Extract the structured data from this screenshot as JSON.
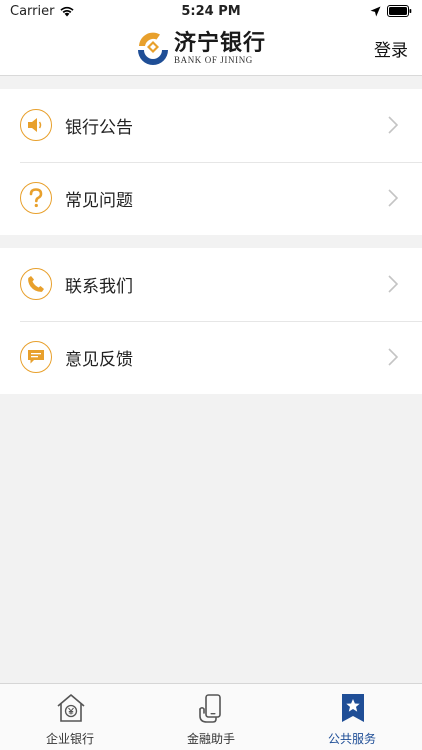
{
  "status_bar": {
    "carrier": "Carrier",
    "time": "5:24 PM"
  },
  "header": {
    "logo_cn": "济宁银行",
    "logo_en": "BANK OF JINING",
    "login_label": "登录"
  },
  "menu": {
    "group1": [
      {
        "label": "银行公告",
        "icon": "speaker-icon"
      },
      {
        "label": "常见问题",
        "icon": "question-icon"
      }
    ],
    "group2": [
      {
        "label": "联系我们",
        "icon": "phone-icon"
      },
      {
        "label": "意见反馈",
        "icon": "message-icon"
      }
    ]
  },
  "tab_bar": {
    "tabs": [
      {
        "label": "企业银行",
        "icon": "house-yen-icon",
        "active": false
      },
      {
        "label": "金融助手",
        "icon": "hand-phone-icon",
        "active": false
      },
      {
        "label": "公共服务",
        "icon": "star-bookmark-icon",
        "active": true
      }
    ]
  },
  "colors": {
    "accent": "#e8a02c",
    "brand_blue": "#1f4e96",
    "background": "#f2f2f2"
  }
}
